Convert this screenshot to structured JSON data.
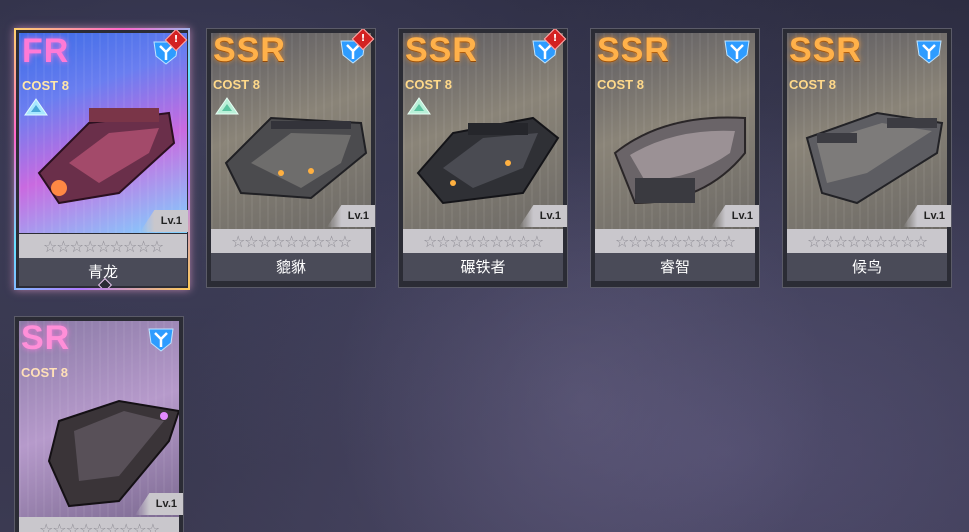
{
  "colors": {
    "ssr_text": "#ffb14a",
    "fr_text": "#ff7ad6",
    "sr_text": "#ff8fd8",
    "faction_blue": "#2e9cff",
    "alert_red": "#d32222"
  },
  "cards": [
    {
      "rarity": "FR",
      "cost": "COST 8",
      "level": "Lv.1",
      "name": "青龙",
      "stars": "☆☆☆☆☆☆☆☆☆",
      "has_alert": true,
      "alert": "!",
      "faction_icon": "faction-shield-icon"
    },
    {
      "rarity": "SSR",
      "cost": "COST 8",
      "level": "Lv.1",
      "name": "貔貅",
      "stars": "☆☆☆☆☆☆☆☆☆",
      "has_alert": true,
      "alert": "!",
      "faction_icon": "faction-shield-icon"
    },
    {
      "rarity": "SSR",
      "cost": "COST 8",
      "level": "Lv.1",
      "name": "碾铁者",
      "stars": "☆☆☆☆☆☆☆☆☆",
      "has_alert": true,
      "alert": "!",
      "faction_icon": "faction-shield-icon"
    },
    {
      "rarity": "SSR",
      "cost": "COST 8",
      "level": "Lv.1",
      "name": "睿智",
      "stars": "☆☆☆☆☆☆☆☆☆",
      "has_alert": false,
      "faction_icon": "faction-shield-icon"
    },
    {
      "rarity": "SSR",
      "cost": "COST 8",
      "level": "Lv.1",
      "name": "候鸟",
      "stars": "☆☆☆☆☆☆☆☆☆",
      "has_alert": false,
      "faction_icon": "faction-shield-icon"
    },
    {
      "rarity": "SR",
      "cost": "COST 8",
      "level": "Lv.1",
      "name": "",
      "stars": "☆☆☆☆☆☆☆☆☆",
      "has_alert": false,
      "faction_icon": "faction-shield-icon"
    }
  ]
}
